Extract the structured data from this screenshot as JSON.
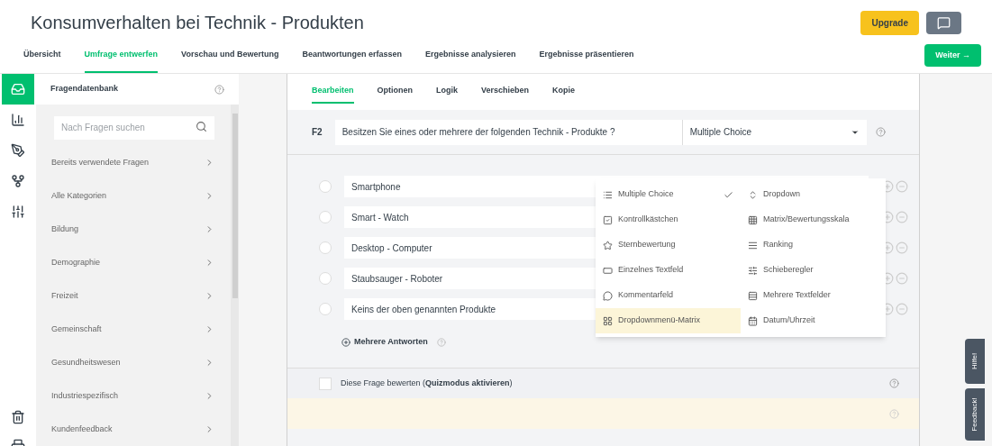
{
  "title": "Konsumverhalten bei Technik - Produkten",
  "upgrade": "Upgrade",
  "next": "Weiter →",
  "nav": [
    {
      "label": "Übersicht",
      "selected": false
    },
    {
      "label": "Umfrage entwerfen",
      "selected": true
    },
    {
      "label": "Vorschau und Bewertung",
      "selected": false
    },
    {
      "label": "Beantwortungen erfassen",
      "selected": false
    },
    {
      "label": "Ergebnisse analysieren",
      "selected": false
    },
    {
      "label": "Ergebnisse präsentieren",
      "selected": false
    }
  ],
  "rail": [
    {
      "kind": "bank",
      "selected": true
    },
    {
      "kind": "chart",
      "selected": false
    },
    {
      "kind": "brush",
      "selected": false
    },
    {
      "kind": "logic",
      "selected": false
    },
    {
      "kind": "sliders",
      "selected": false
    }
  ],
  "sidebar": {
    "title": "Fragendatenbank",
    "search": {
      "placeholder": "Nach Fragen suchen"
    },
    "items": [
      "Bereits verwendete Fragen",
      "Alle Kategorien",
      "Bildung",
      "Demographie",
      "Freizeit",
      "Gemeinschaft",
      "Gesundheitswesen",
      "Industriespezifisch",
      "Kundenfeedback"
    ]
  },
  "tabs": [
    {
      "label": "Bearbeiten",
      "selected": true
    },
    {
      "label": "Optionen",
      "selected": false
    },
    {
      "label": "Logik",
      "selected": false
    },
    {
      "label": "Verschieben",
      "selected": false
    },
    {
      "label": "Kopie",
      "selected": false
    }
  ],
  "question": {
    "number": "F2",
    "text": "Besitzen Sie eines oder mehrere der folgenden Technik - Produkte ?",
    "type": "Multiple Choice"
  },
  "answers": [
    {
      "label": "Smartphone",
      "checked": false
    },
    {
      "label": "Smart - Watch",
      "checked": false
    },
    {
      "label": "Desktop - Computer",
      "checked": false
    },
    {
      "label": "Staubsauger - Roboter",
      "checked": false
    },
    {
      "label": "Keins der oben genannten Produkte",
      "checked": false
    }
  ],
  "quiz_checked": false,
  "multi": "Mehrere Antworten",
  "quiz": "Diese Frage bewerten (**Quizmodus aktivieren**)",
  "menu": [
    {
      "kind": "list",
      "label": "Multiple Choice",
      "checked": true,
      "highlighted": false
    },
    {
      "kind": "dropdown",
      "label": "Dropdown",
      "checked": false,
      "highlighted": false
    },
    {
      "kind": "checkbox",
      "label": "Kontrollkästchen",
      "checked": false,
      "highlighted": false
    },
    {
      "kind": "matrix",
      "label": "Matrix/Bewertungsskala",
      "checked": false,
      "highlighted": false
    },
    {
      "kind": "star",
      "label": "Sternbewertung",
      "checked": false,
      "highlighted": false
    },
    {
      "kind": "ranking",
      "label": "Ranking",
      "checked": false,
      "highlighted": false
    },
    {
      "kind": "textfield",
      "label": "Einzelnes Textfeld",
      "checked": false,
      "highlighted": false
    },
    {
      "kind": "slider",
      "label": "Schieberegler",
      "checked": false,
      "highlighted": false
    },
    {
      "kind": "comment",
      "label": "Kommentarfeld",
      "checked": false,
      "highlighted": false
    },
    {
      "kind": "multitext",
      "label": "Mehrere Textfelder",
      "checked": false,
      "highlighted": false
    },
    {
      "kind": "dropmatrix",
      "label": "Dropdownmenü-Matrix",
      "checked": false,
      "highlighted": true
    },
    {
      "kind": "date",
      "label": "Datum/Uhrzeit",
      "checked": false,
      "highlighted": false
    }
  ],
  "side_tabs": [
    "Hilfe!",
    "Feedback!"
  ]
}
